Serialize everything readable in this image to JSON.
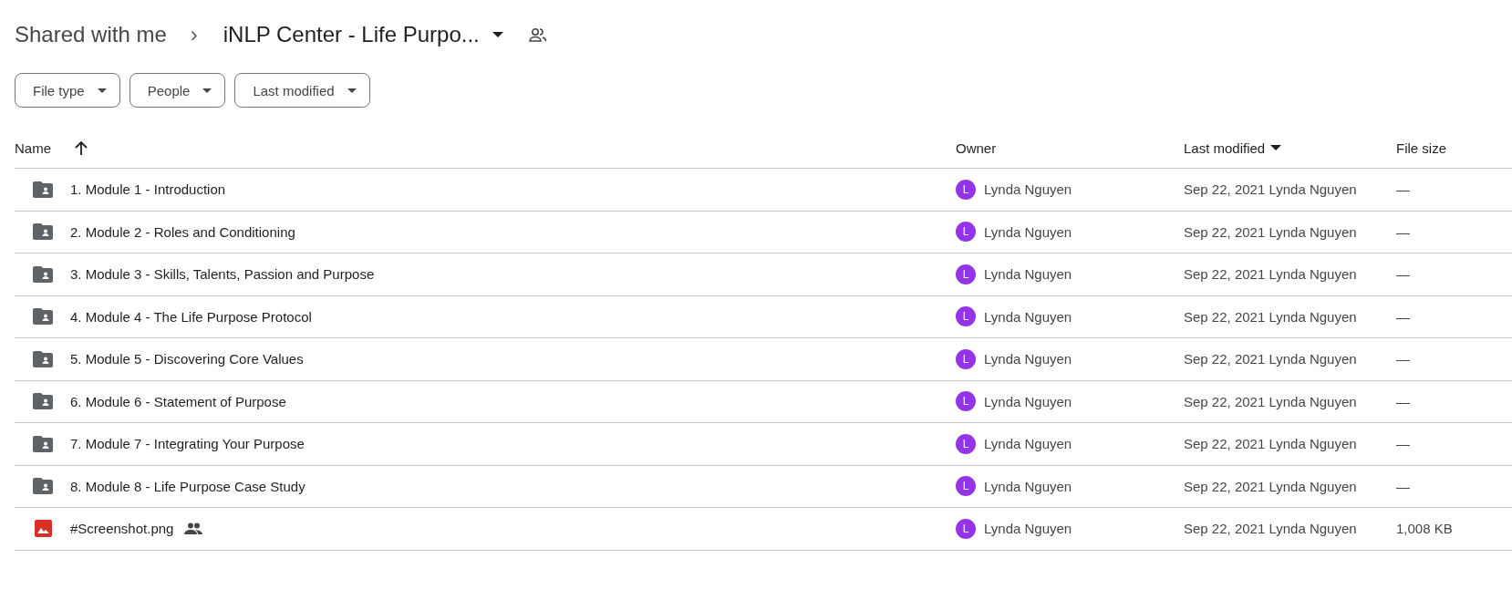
{
  "breadcrumb": {
    "parent": "Shared with me",
    "separator": "›",
    "current": "iNLP Center - Life Purpo..."
  },
  "filters": [
    {
      "label": "File type"
    },
    {
      "label": "People"
    },
    {
      "label": "Last modified"
    }
  ],
  "table": {
    "columns": [
      {
        "label": "Name",
        "sorted": true,
        "descending": false
      },
      {
        "label": "Owner",
        "sorted": false
      },
      {
        "label": "Last modified",
        "sorted": true,
        "descending": true
      },
      {
        "label": "File size",
        "sorted": false
      }
    ],
    "rows": [
      {
        "kind": "folder",
        "name": "1. Module 1 - Introduction",
        "shared": false,
        "owner_initial": "L",
        "owner": "Lynda Nguyen",
        "modified": "Sep 22, 2021 Lynda Nguyen",
        "size": "—"
      },
      {
        "kind": "folder",
        "name": "2. Module 2 - Roles and Conditioning",
        "shared": false,
        "owner_initial": "L",
        "owner": "Lynda Nguyen",
        "modified": "Sep 22, 2021 Lynda Nguyen",
        "size": "—"
      },
      {
        "kind": "folder",
        "name": "3. Module 3 - Skills, Talents, Passion and Purpose",
        "shared": false,
        "owner_initial": "L",
        "owner": "Lynda Nguyen",
        "modified": "Sep 22, 2021 Lynda Nguyen",
        "size": "—"
      },
      {
        "kind": "folder",
        "name": "4. Module 4 - The Life Purpose Protocol",
        "shared": false,
        "owner_initial": "L",
        "owner": "Lynda Nguyen",
        "modified": "Sep 22, 2021 Lynda Nguyen",
        "size": "—"
      },
      {
        "kind": "folder",
        "name": "5. Module 5 - Discovering Core Values",
        "shared": false,
        "owner_initial": "L",
        "owner": "Lynda Nguyen",
        "modified": "Sep 22, 2021 Lynda Nguyen",
        "size": "—"
      },
      {
        "kind": "folder",
        "name": "6. Module 6 - Statement of Purpose",
        "shared": false,
        "owner_initial": "L",
        "owner": "Lynda Nguyen",
        "modified": "Sep 22, 2021 Lynda Nguyen",
        "size": "—"
      },
      {
        "kind": "folder",
        "name": "7. Module 7 - Integrating Your Purpose",
        "shared": false,
        "owner_initial": "L",
        "owner": "Lynda Nguyen",
        "modified": "Sep 22, 2021 Lynda Nguyen",
        "size": "—"
      },
      {
        "kind": "folder",
        "name": "8. Module 8 - Life Purpose Case Study",
        "shared": false,
        "owner_initial": "L",
        "owner": "Lynda Nguyen",
        "modified": "Sep 22, 2021 Lynda Nguyen",
        "size": "—"
      },
      {
        "kind": "image",
        "name": "#Screenshot.png",
        "shared": true,
        "owner_initial": "L",
        "owner": "Lynda Nguyen",
        "modified": "Sep 22, 2021 Lynda Nguyen",
        "size": "1,008 KB"
      }
    ]
  }
}
